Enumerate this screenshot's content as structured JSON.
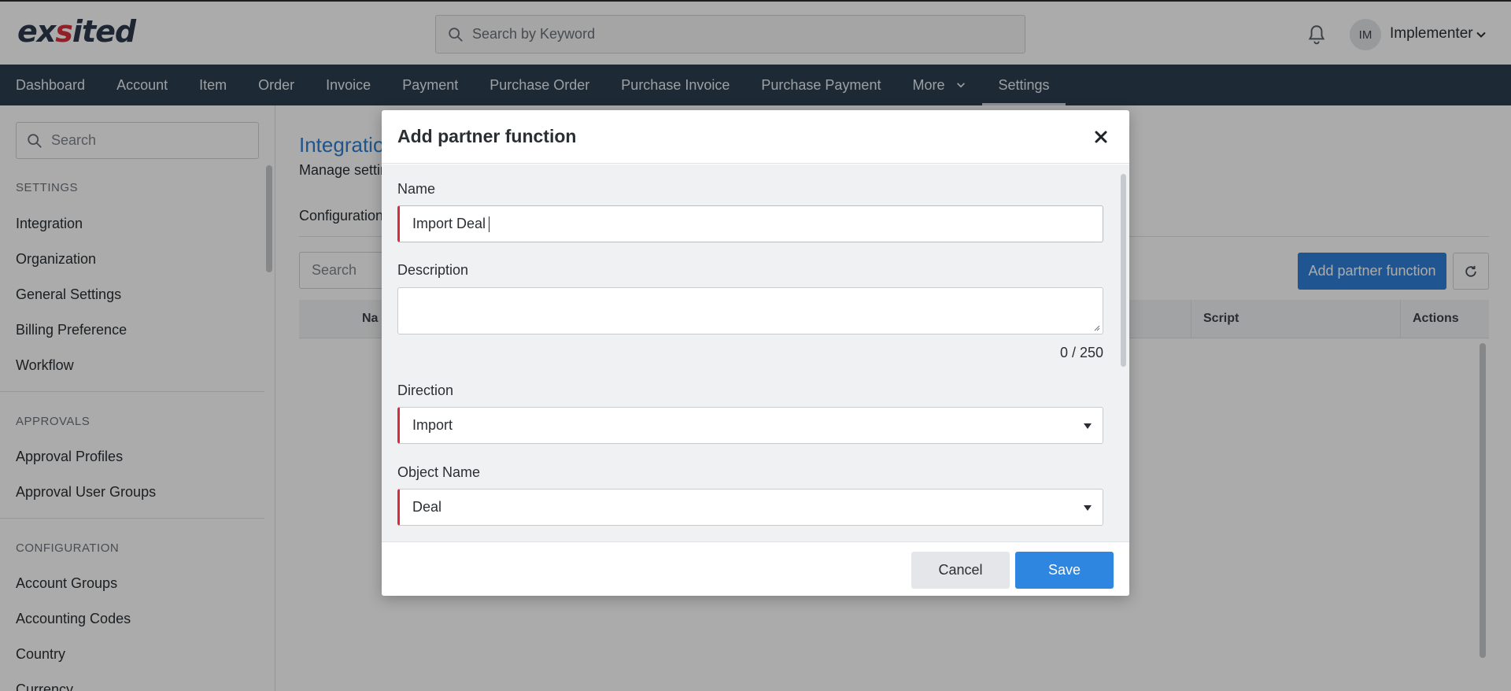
{
  "header": {
    "logo": "exsited",
    "search_placeholder": "Search by Keyword",
    "avatar_initials": "IM",
    "user_name": "Implementer"
  },
  "nav": {
    "items": [
      "Dashboard",
      "Account",
      "Item",
      "Order",
      "Invoice",
      "Payment",
      "Purchase Order",
      "Purchase Invoice",
      "Purchase Payment"
    ],
    "more_label": "More",
    "settings_label": "Settings"
  },
  "sidebar": {
    "search_placeholder": "Search",
    "sections": [
      {
        "title": "SETTINGS",
        "items": [
          "Integration",
          "Organization",
          "General Settings",
          "Billing Preference",
          "Workflow"
        ]
      },
      {
        "title": "APPROVALS",
        "items": [
          "Approval Profiles",
          "Approval User Groups"
        ]
      },
      {
        "title": "CONFIGURATION",
        "items": [
          "Account Groups",
          "Accounting Codes",
          "Country",
          "Currency"
        ]
      }
    ]
  },
  "main": {
    "title": "Integratio",
    "subtitle": "Manage settir",
    "tab": "Configuration",
    "search_placeholder": "Search",
    "add_button": "Add partner function",
    "columns": [
      "Na",
      "Script",
      "Actions"
    ]
  },
  "modal": {
    "title": "Add partner function",
    "name_label": "Name",
    "name_value": "Import Deal",
    "description_label": "Description",
    "description_value": "",
    "counter": "0 / 250",
    "direction_label": "Direction",
    "direction_value": "Import",
    "object_label": "Object Name",
    "object_value": "Deal",
    "cancel_label": "Cancel",
    "save_label": "Save"
  },
  "colors": {
    "nav_bg": "#2c3e50",
    "accent": "#2f80d8",
    "required": "#d92b3b"
  }
}
